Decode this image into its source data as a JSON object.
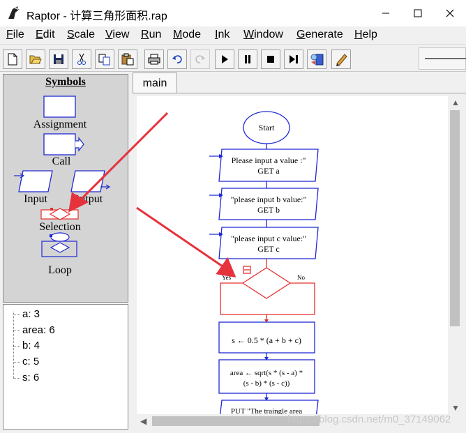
{
  "window": {
    "title": "Raptor - 计算三角形面积.rap",
    "controls": [
      "minimize",
      "maximize",
      "close"
    ]
  },
  "menu": [
    "File",
    "Edit",
    "Scale",
    "View",
    "Run",
    "Mode",
    "Ink",
    "Window",
    "Generate",
    "Help"
  ],
  "toolbar": [
    {
      "icon": "new-file-icon",
      "enabled": true
    },
    {
      "icon": "open-folder-icon",
      "enabled": true
    },
    {
      "icon": "save-icon",
      "enabled": true
    },
    {
      "icon": "cut-icon",
      "enabled": true
    },
    {
      "icon": "copy-icon",
      "enabled": true
    },
    {
      "icon": "paste-icon",
      "enabled": true
    },
    {
      "icon": "print-icon",
      "enabled": true
    },
    {
      "icon": "undo-icon",
      "enabled": true
    },
    {
      "icon": "redo-icon",
      "enabled": false
    },
    {
      "icon": "play-icon",
      "enabled": true
    },
    {
      "icon": "pause-icon",
      "enabled": true
    },
    {
      "icon": "stop-icon",
      "enabled": true
    },
    {
      "icon": "step-icon",
      "enabled": true
    },
    {
      "icon": "test-server-icon",
      "enabled": true
    },
    {
      "icon": "ink-pen-icon",
      "enabled": true
    }
  ],
  "symbols": {
    "title": "Symbols",
    "items": {
      "assignment": "Assignment",
      "call": "Call",
      "input": "Input",
      "output": "Output",
      "selection": "Selection",
      "loop": "Loop"
    }
  },
  "variables": [
    "a: 3",
    "area: 6",
    "b: 4",
    "c: 5",
    "s: 6"
  ],
  "tabs": [
    "main"
  ],
  "flowchart": {
    "start": "Start",
    "input1": {
      "prompt": "Please input a value :\"",
      "get": "GET a"
    },
    "input2": {
      "prompt": "\"please input b value:\"",
      "get": "GET b"
    },
    "input3": {
      "prompt": "\"please input c value:\"",
      "get": "GET c"
    },
    "selection": {
      "yes": "Yes",
      "no": "No"
    },
    "assign1": "s ← 0.5 * (a + b + c)",
    "assign2": {
      "line1": "area ← sqrt(s * (s - a) *",
      "line2": "(s - b) * (s - c))"
    },
    "output": "PUT \"The traingle area"
  },
  "colors": {
    "flow_blue": "#1e28d2",
    "selection_red": "#e62d2d",
    "annotation_arrow": "#e6323c"
  },
  "watermark": "https://blog.csdn.net/m0_37149062"
}
